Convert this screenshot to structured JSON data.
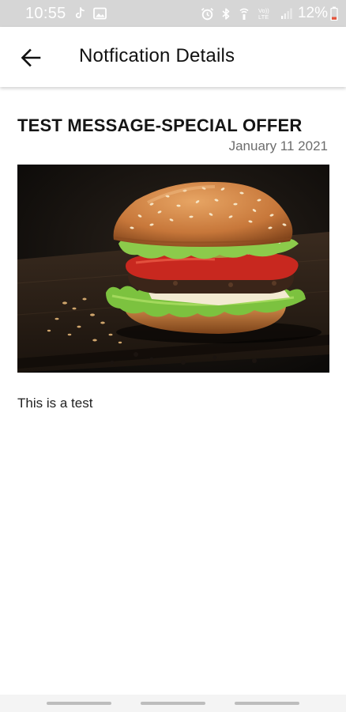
{
  "status_bar": {
    "time": "10:55",
    "battery_percent": "12%",
    "left_icons": [
      "tiktok-notification-icon",
      "gallery-notification-icon"
    ],
    "right_icons": [
      "alarm-icon",
      "bluetooth-icon",
      "hotspot-icon",
      "volte-signal-icon",
      "signal-strength-icon",
      "battery-low-icon"
    ],
    "colors": {
      "background": "#d6d6d6",
      "foreground": "#ffffff",
      "battery_low": "#e5533b"
    }
  },
  "app_bar": {
    "title": "Notfication Details",
    "back_icon": "arrow-back-icon"
  },
  "message": {
    "title": "TEST MESSAGE-SPECIAL OFFER",
    "date": "January 11 2021",
    "image": "burger-photo",
    "body": "This is a test"
  },
  "nav_bar": {
    "items": [
      "recents-pill",
      "home-pill",
      "back-pill"
    ]
  }
}
